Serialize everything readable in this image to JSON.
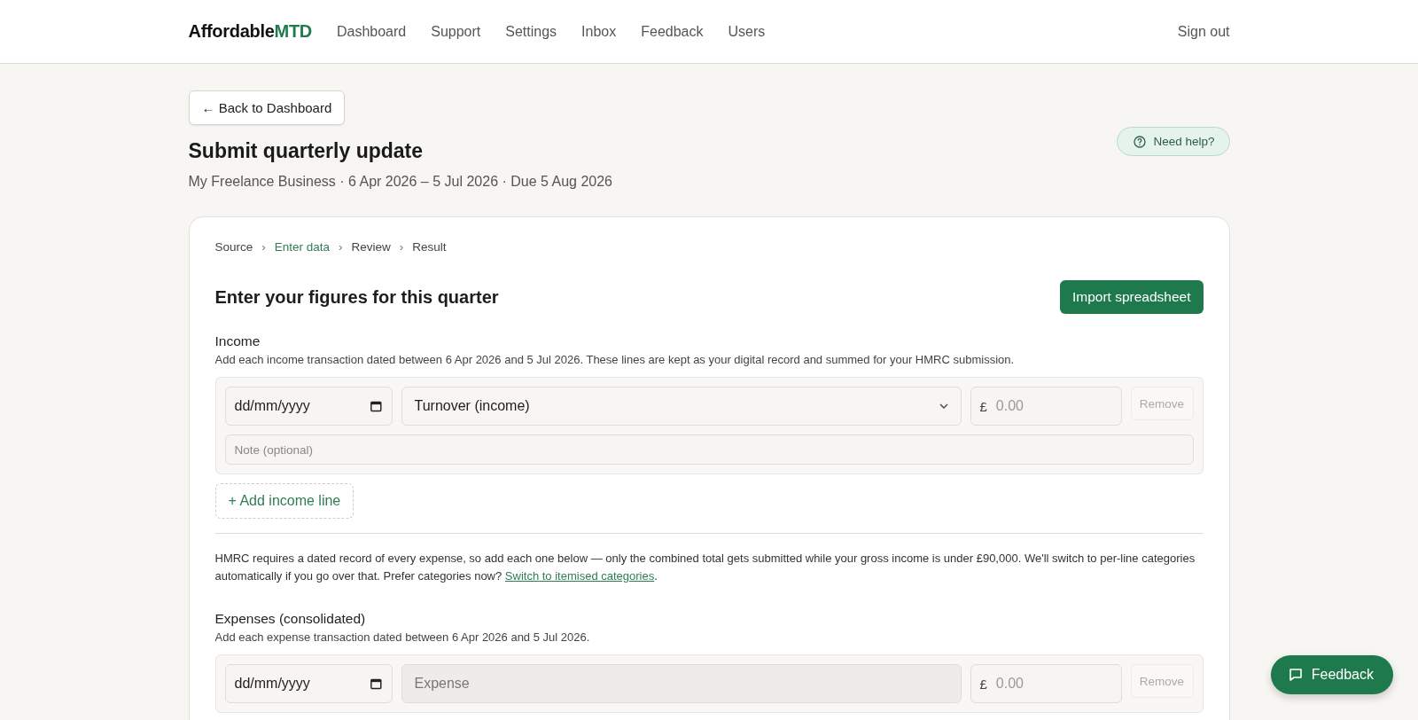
{
  "nav": {
    "logo": "Affordable",
    "logo_accent": "MTD",
    "links": [
      {
        "label": "Dashboard"
      },
      {
        "label": "Support"
      },
      {
        "label": "Settings"
      },
      {
        "label": "Inbox"
      },
      {
        "label": "Feedback"
      },
      {
        "label": "Users"
      }
    ],
    "sign_out": "Sign out"
  },
  "back_button": "← Back to Dashboard",
  "page": {
    "title": "Submit quarterly update",
    "subtitle": "My Freelance Business · 6 Apr 2026 – 5 Jul 2026 · Due 5 Aug 2026"
  },
  "help_button": "Need help?",
  "step_separator": "›",
  "steps": [
    {
      "label": "Source",
      "selected": false
    },
    {
      "label": "Enter data",
      "selected": true
    },
    {
      "label": "Review",
      "selected": false
    },
    {
      "label": "Result",
      "selected": false
    }
  ],
  "section_title": "Enter your figures for this quarter",
  "import_button": "Import spreadsheet",
  "income": {
    "title": "Income",
    "description": "Add each income transaction dated between 6 Apr 2026 and 5 Jul 2026. These lines are kept as your digital record and summed for your HMRC submission.",
    "lines": [
      {
        "date_placeholder": "dd/mm/yyyy",
        "category": "Turnover (income)",
        "category_disabled": false,
        "currency": "£",
        "amount_placeholder": "0.00",
        "remove": "Remove",
        "remove_disabled": true,
        "note_placeholder": "Note (optional)"
      }
    ],
    "add_button": "+ Add income line"
  },
  "notice": {
    "text": "HMRC requires a dated record of every expense, so add each one below — only the combined total gets submitted while your gross income is under £90,000. We'll switch to per-line categories automatically if you go over that. Prefer categories now? ",
    "link": "Switch to itemised categories",
    "end": "."
  },
  "expenses": {
    "title": "Expenses (consolidated)",
    "description": "Add each expense transaction dated between 6 Apr 2026 and 5 Jul 2026.",
    "lines": [
      {
        "date_placeholder": "dd/mm/yyyy",
        "category": "Expense",
        "category_disabled": true,
        "currency": "£",
        "amount_placeholder": "0.00",
        "remove": "Remove",
        "remove_disabled": true
      }
    ]
  },
  "feedback_button": "Feedback"
}
